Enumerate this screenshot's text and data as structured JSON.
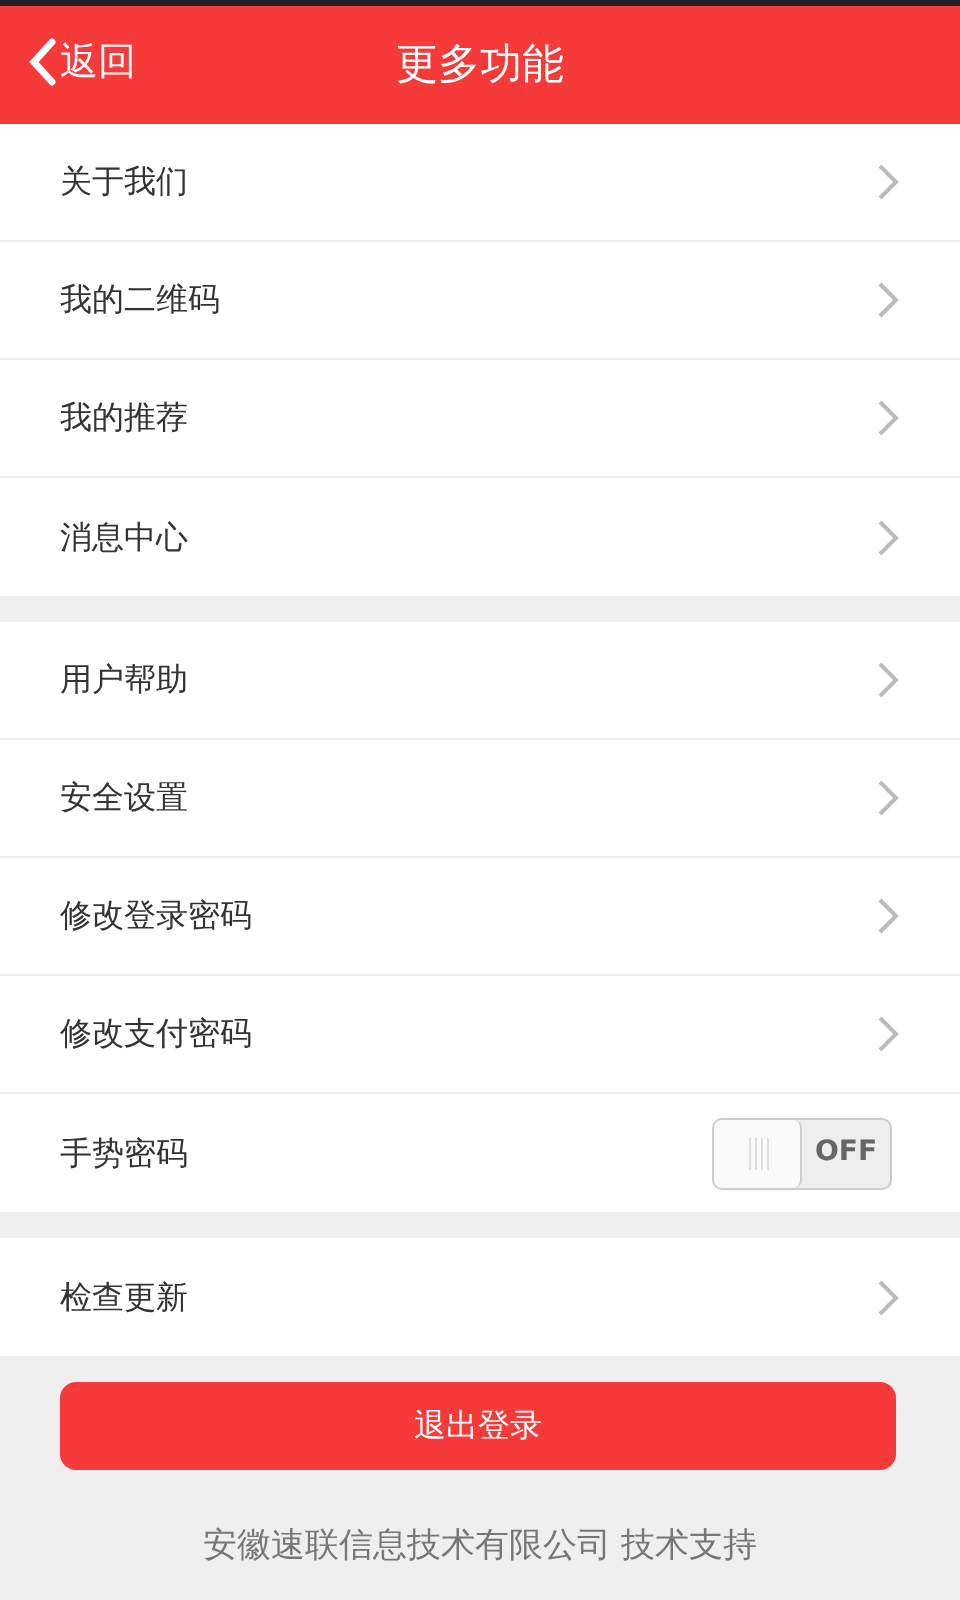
{
  "header": {
    "back": "返回",
    "title": "更多功能"
  },
  "groups": [
    {
      "items": [
        {
          "kind": "link",
          "label": "关于我们"
        },
        {
          "kind": "link",
          "label": "我的二维码"
        },
        {
          "kind": "link",
          "label": "我的推荐"
        },
        {
          "kind": "link",
          "label": "消息中心"
        }
      ]
    },
    {
      "items": [
        {
          "kind": "link",
          "label": "用户帮助"
        },
        {
          "kind": "link",
          "label": "安全设置"
        },
        {
          "kind": "link",
          "label": "修改登录密码"
        },
        {
          "kind": "link",
          "label": "修改支付密码"
        },
        {
          "kind": "toggle",
          "label": "手势密码",
          "on": false,
          "state_text": "OFF"
        }
      ]
    },
    {
      "items": [
        {
          "kind": "link",
          "label": "检查更新"
        }
      ]
    }
  ],
  "logout_button": "退出登录",
  "footer": "安徽速联信息技术有限公司 技术支持"
}
